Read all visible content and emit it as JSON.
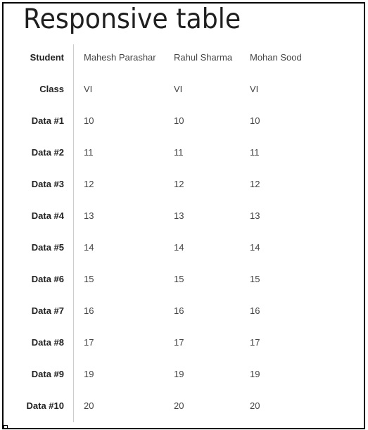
{
  "page": {
    "title": "Responsive table"
  },
  "table": {
    "rows": [
      {
        "label": "Student",
        "values": [
          "Mahesh Parashar",
          "Rahul Sharma",
          "Mohan Sood"
        ]
      },
      {
        "label": "Class",
        "values": [
          "VI",
          "VI",
          "VI"
        ]
      },
      {
        "label": "Data #1",
        "values": [
          "10",
          "10",
          "10"
        ]
      },
      {
        "label": "Data #2",
        "values": [
          "11",
          "11",
          "11"
        ]
      },
      {
        "label": "Data #3",
        "values": [
          "12",
          "12",
          "12"
        ]
      },
      {
        "label": "Data #4",
        "values": [
          "13",
          "13",
          "13"
        ]
      },
      {
        "label": "Data #5",
        "values": [
          "14",
          "14",
          "14"
        ]
      },
      {
        "label": "Data #6",
        "values": [
          "15",
          "15",
          "15"
        ]
      },
      {
        "label": "Data #7",
        "values": [
          "16",
          "16",
          "16"
        ]
      },
      {
        "label": "Data #8",
        "values": [
          "17",
          "17",
          "17"
        ]
      },
      {
        "label": "Data #9",
        "values": [
          "19",
          "19",
          "19"
        ]
      },
      {
        "label": "Data #10",
        "values": [
          "20",
          "20",
          "20"
        ]
      }
    ]
  },
  "colors": {
    "divider": "#cccccc",
    "header_text": "#222222",
    "cell_text": "#444444"
  }
}
